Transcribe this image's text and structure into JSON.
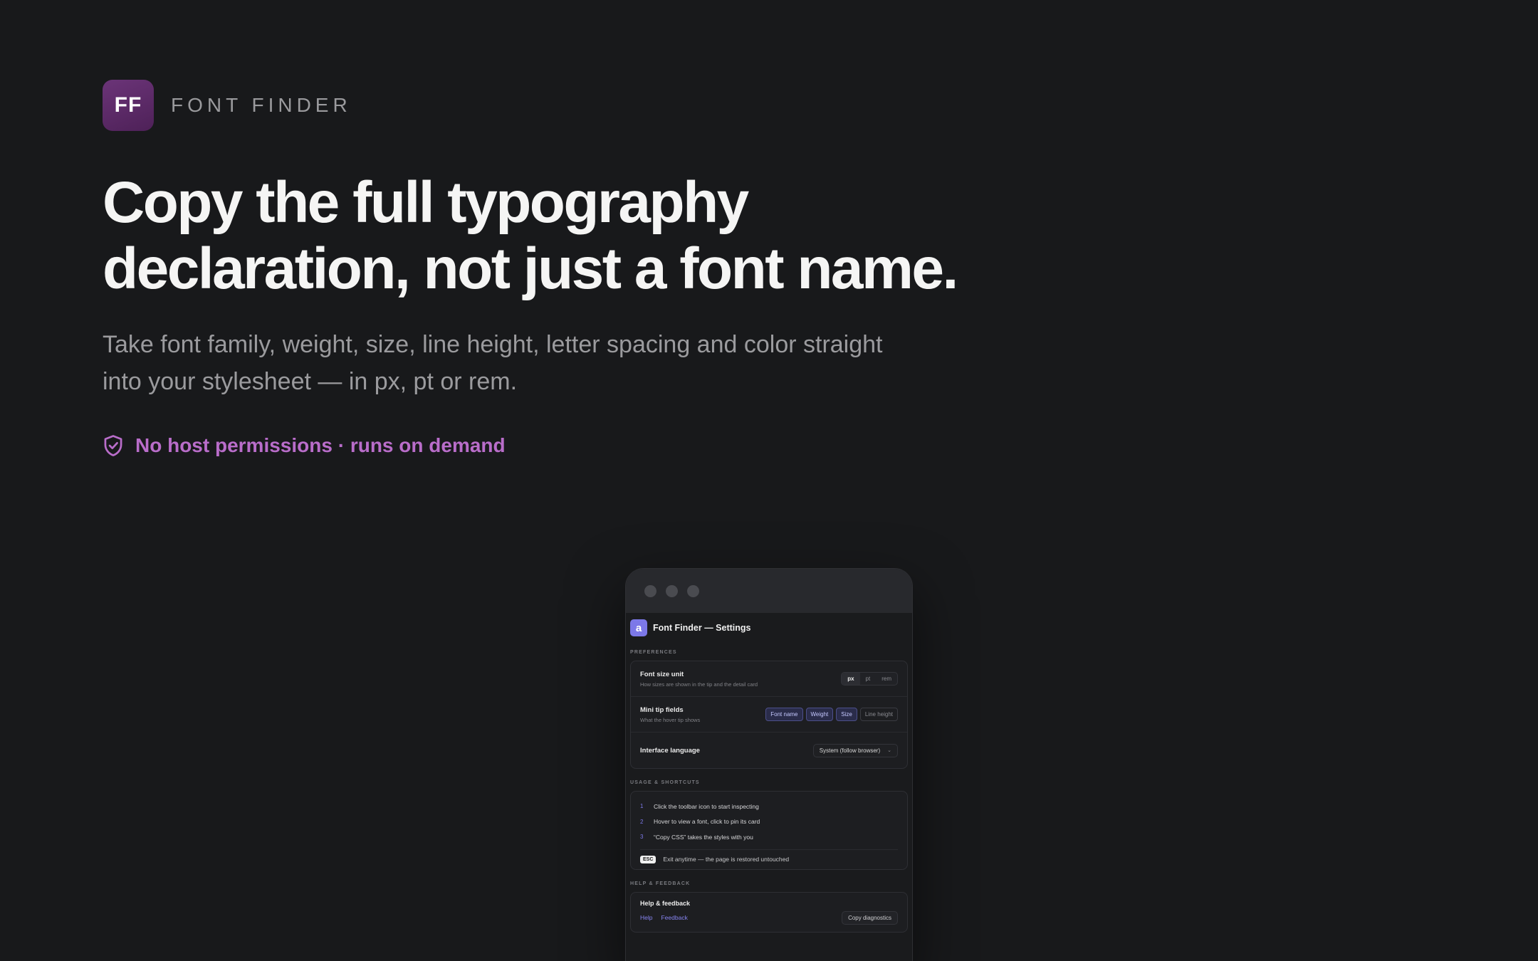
{
  "brand": {
    "logo_text": "FF",
    "name": "FONT FINDER"
  },
  "hero": {
    "headline_line1": "Copy the full typography",
    "headline_line2": "declaration, not just a font name.",
    "subtitle_line1": "Take font family, weight, size, line height, letter spacing and color straight",
    "subtitle_line2": "into your stylesheet — in px, pt or rem.",
    "badge": "No host permissions · runs on demand",
    "badge_icon": "shield-check-icon",
    "accent_color": "#b96dca"
  },
  "settings": {
    "logo_text": "a",
    "title": "Font Finder — Settings",
    "preferences": {
      "section_label": "PREFERENCES",
      "font_size_unit": {
        "title": "Font size unit",
        "description": "How sizes are shown in the tip and the detail card",
        "options": [
          "px",
          "pt",
          "rem"
        ],
        "selected": "px"
      },
      "mini_tip": {
        "title": "Mini tip fields",
        "description": "What the hover tip shows",
        "chips": [
          "Font name",
          "Weight",
          "Size",
          "Line height"
        ]
      },
      "language": {
        "title": "Interface language",
        "value": "System (follow browser)"
      }
    },
    "usage": {
      "section_label": "USAGE & SHORTCUTS",
      "steps": [
        {
          "num": "1",
          "text": "Click the toolbar icon to start inspecting"
        },
        {
          "num": "2",
          "text": "Hover to view a font, click to pin its card"
        },
        {
          "num": "3",
          "text": "“Copy CSS” takes the styles with you"
        }
      ],
      "esc_key": "ESC",
      "esc_text": "Exit anytime — the page is restored untouched"
    },
    "help": {
      "section_label": "HELP & FEEDBACK",
      "title": "Help & feedback",
      "link_help": "Help",
      "link_feedback": "Feedback",
      "diagnostics_button": "Copy diagnostics"
    }
  }
}
